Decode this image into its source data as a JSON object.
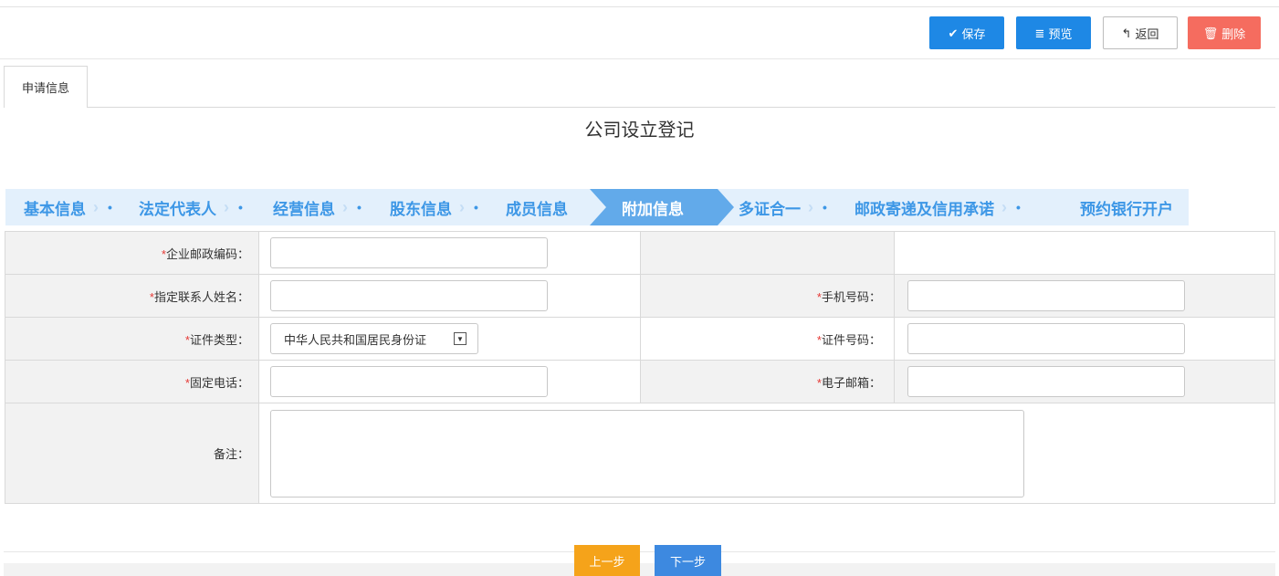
{
  "toolbar": {
    "save_label": "保存",
    "preview_label": "预览",
    "back_label": "返回",
    "delete_label": "删除"
  },
  "tabs": [
    {
      "label": "申请信息"
    }
  ],
  "page": {
    "title": "公司设立登记"
  },
  "steps": [
    {
      "label": "基本信息"
    },
    {
      "label": "法定代表人"
    },
    {
      "label": "经营信息"
    },
    {
      "label": "股东信息"
    },
    {
      "label": "成员信息"
    },
    {
      "label": "附加信息",
      "active": true
    },
    {
      "label": "多证合一"
    },
    {
      "label": "邮政寄递及信用承诺"
    },
    {
      "label": "预约银行开户"
    }
  ],
  "form": {
    "postal_code_label": "企业邮政编码：",
    "contact_name_label": "指定联系人姓名：",
    "mobile_label": "手机号码：",
    "id_type_label": "证件类型：",
    "id_type_value": "中华人民共和国居民身份证",
    "id_number_label": "证件号码：",
    "phone_label": "固定电话：",
    "email_label": "电子邮箱：",
    "remark_label": "备注：",
    "required_mark": "*"
  },
  "footer": {
    "prev_label": "上一步",
    "next_label": "下一步"
  },
  "colors": {
    "primary": "#1e88e5",
    "danger": "#f56c5f",
    "warning": "#f5a31a",
    "step_text": "#3d97e6",
    "step_bg": "#e3f0fc",
    "step_active_bg": "#62aaea"
  }
}
